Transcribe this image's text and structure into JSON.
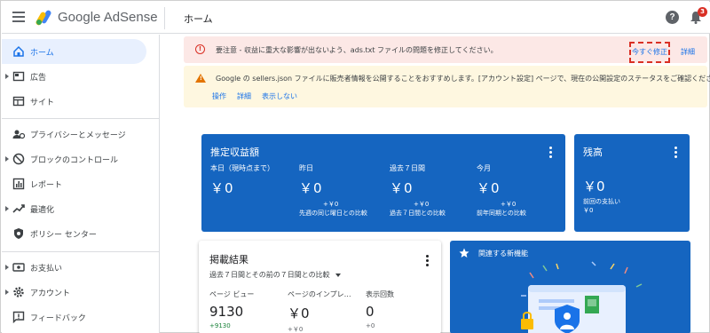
{
  "header": {
    "brand": "Google AdSense",
    "page_title": "ホーム",
    "help_icon": "?",
    "notification_count": "3"
  },
  "sidebar": {
    "items": [
      {
        "label": "ホーム",
        "icon": "home-icon",
        "active": true
      },
      {
        "label": "広告",
        "icon": "ads-icon"
      },
      {
        "label": "サイト",
        "icon": "sites-icon"
      },
      {
        "label": "プライバシーとメッセージ",
        "icon": "privacy-icon"
      },
      {
        "label": "ブロックのコントロール",
        "icon": "block-icon"
      },
      {
        "label": "レポート",
        "icon": "reports-icon"
      },
      {
        "label": "最適化",
        "icon": "optimize-icon"
      },
      {
        "label": "ポリシー センター",
        "icon": "policy-icon"
      },
      {
        "label": "お支払い",
        "icon": "payments-icon"
      },
      {
        "label": "アカウント",
        "icon": "account-icon"
      },
      {
        "label": "フィードバック",
        "icon": "feedback-icon"
      }
    ]
  },
  "alerts": {
    "error": {
      "icon": "!",
      "message": "要注意 - 収益に重大な影響が出ないよう、ads.txt ファイルの問題を修正してください。",
      "fix_now": "今すぐ修正",
      "details": "詳細"
    },
    "warning": {
      "icon": "!",
      "message": "Google の sellers.json ファイルに販売者情報を公開することをおすすめします。[アカウント設定] ページで、現在の公開設定のステータスをご確認ください。",
      "actions": [
        "操作",
        "詳細",
        "表示しない"
      ]
    }
  },
  "earnings": {
    "title": "推定収益額",
    "columns": [
      {
        "label": "本日（現時点まで）",
        "value": "￥0",
        "delta": "",
        "compare": ""
      },
      {
        "label": "昨日",
        "value": "￥0",
        "delta": "+￥0",
        "compare": "先週の同じ曜日との比較"
      },
      {
        "label": "過去７日間",
        "value": "￥0",
        "delta": "+￥0",
        "compare": "過去７日間との比較"
      },
      {
        "label": "今月",
        "value": "￥0",
        "delta": "+￥0",
        "compare": "前年同期との比較"
      }
    ]
  },
  "balance": {
    "title": "残高",
    "value": "￥0",
    "last_payment_label": "前回の支払い",
    "last_payment_value": "￥0"
  },
  "performance": {
    "title": "掲載結果",
    "period": "過去７日間とその前の７日間との比較",
    "metrics": [
      {
        "label": "ページ ビュー",
        "value": "9130",
        "delta": "+9130"
      },
      {
        "label": "ページのインプレ…",
        "value": "￥0",
        "delta": "+￥0"
      },
      {
        "label": "表示回数",
        "value": "0",
        "delta": "+0"
      }
    ]
  },
  "new_features": {
    "title": "関連する新機能"
  },
  "colors": {
    "accent": "#1a73e8",
    "card_blue": "#1565c0",
    "error_bg": "#fce8e6",
    "warning_bg": "#fef7e0",
    "error": "#d93025"
  }
}
